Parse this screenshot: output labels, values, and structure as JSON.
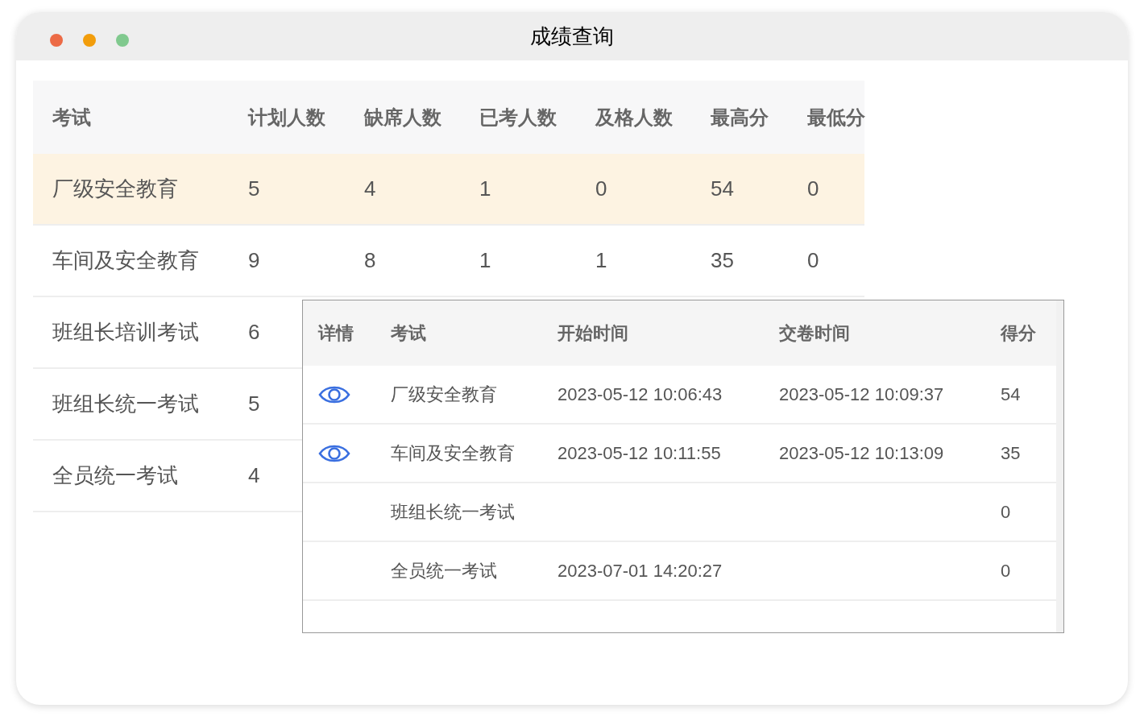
{
  "window": {
    "title": "成绩查询"
  },
  "table": {
    "columns": [
      "考试",
      "计划人数",
      "缺席人数",
      "已考人数",
      "及格人数",
      "最高分",
      "最低分"
    ],
    "rows": [
      {
        "selected": true,
        "cells": [
          "厂级安全教育",
          "5",
          "4",
          "1",
          "0",
          "54",
          "0"
        ]
      },
      {
        "selected": false,
        "cells": [
          "车间及安全教育",
          "9",
          "8",
          "1",
          "1",
          "35",
          "0"
        ]
      },
      {
        "selected": false,
        "cells": [
          "班组长培训考试",
          "6"
        ]
      },
      {
        "selected": false,
        "cells": [
          "班组长统一考试",
          "5"
        ]
      },
      {
        "selected": false,
        "cells": [
          "全员统一考试",
          "4"
        ]
      }
    ]
  },
  "popup": {
    "columns": [
      "详情",
      "考试",
      "开始时间",
      "交卷时间",
      "得分"
    ],
    "rows": [
      {
        "details_link": true,
        "exam": "厂级安全教育",
        "start": "2023-05-12 10:06:43",
        "submit": "2023-05-12 10:09:37",
        "score": "54"
      },
      {
        "details_link": true,
        "exam": "车间及安全教育",
        "start": "2023-05-12 10:11:55",
        "submit": "2023-05-12 10:13:09",
        "score": "35"
      },
      {
        "details_link": false,
        "exam": "班组长统一考试",
        "score": "0"
      },
      {
        "details_link": false,
        "exam": "全员统一考试",
        "start": "2023-07-01 14:20:27",
        "score": "0"
      }
    ]
  }
}
